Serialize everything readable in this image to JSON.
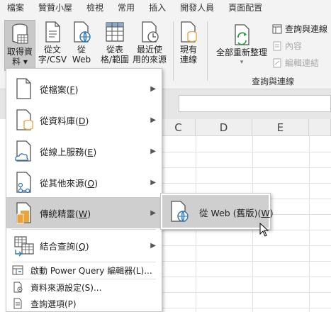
{
  "tabs": [
    "檔案",
    "贊贊小屋",
    "檢視",
    "常用",
    "插入",
    "開發人員",
    "頁面配置"
  ],
  "ribbon": {
    "get_data": {
      "line1": "取得資",
      "line2": "料 ▾"
    },
    "from_text": {
      "line1": "從文",
      "line2": "字/CSV"
    },
    "from_web": {
      "line1": "從",
      "line2": "Web"
    },
    "from_table": {
      "line1": "從表",
      "line2": "格/範圍"
    },
    "recent_sources": {
      "line1": "最近使",
      "line2": "用的來源"
    },
    "existing_connections": {
      "line1": "現有",
      "line2": "連線"
    },
    "refresh_all": {
      "line1": "全部重新整理",
      "line2": "▾"
    },
    "queries_connections": "查詢與連線",
    "properties": "內容",
    "edit_links": "編輯連結",
    "group_label": "查詢與連線"
  },
  "columns": [
    "C",
    "D",
    "E"
  ],
  "menu": {
    "items": [
      {
        "label": "從檔案",
        "key": "F"
      },
      {
        "label": "從資料庫",
        "key": "D"
      },
      {
        "label": "從線上服務",
        "key": "E"
      },
      {
        "label": "從其他來源",
        "key": "O"
      },
      {
        "label": "傳統精靈",
        "key": "W"
      },
      {
        "label": "結合查詢",
        "key": "Q"
      }
    ],
    "small_items": [
      {
        "label": "啟動 Power Query 編輯器(L)..."
      },
      {
        "label": "資料來源設定(S)..."
      },
      {
        "label": "查詢選項(P)"
      }
    ]
  },
  "submenu": {
    "label": "從 Web (舊版)",
    "key": "W"
  },
  "colors": {
    "selected": "#cfcfcf",
    "accent_blue": "#2e75b6",
    "accent_orange": "#e8a33a",
    "accent_green": "#2f9e44"
  }
}
